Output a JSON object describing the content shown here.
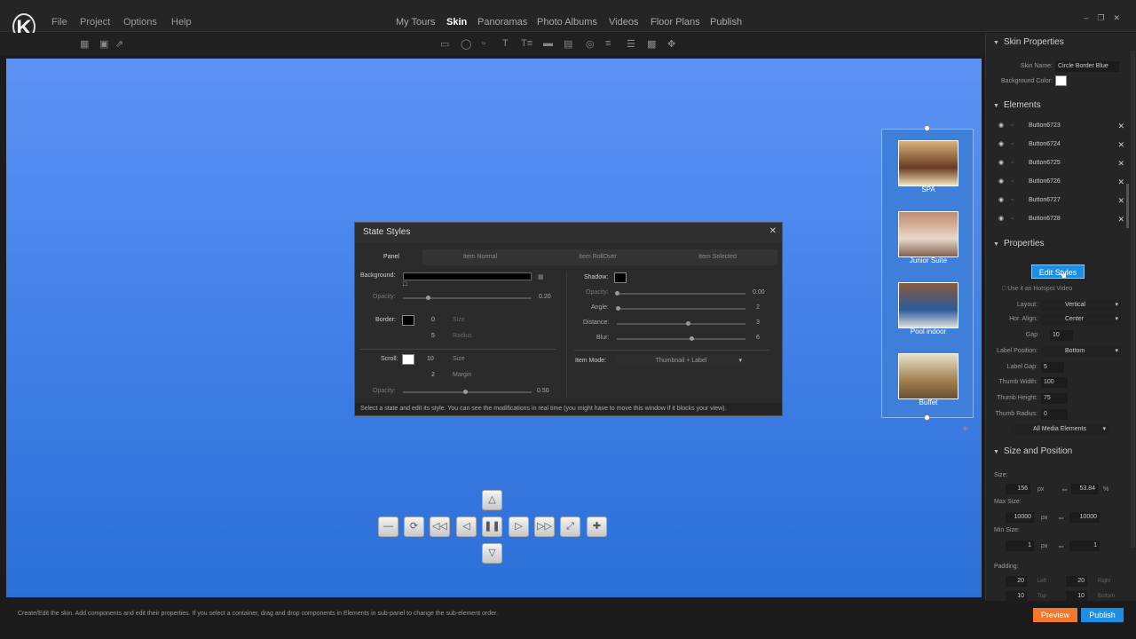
{
  "menu": [
    "File",
    "Project",
    "Options",
    "Help"
  ],
  "tabs": [
    {
      "label": "My Tours",
      "active": false
    },
    {
      "label": "Skin",
      "active": true
    },
    {
      "label": "Panoramas",
      "active": false
    },
    {
      "label": "Photo Albums",
      "active": false
    },
    {
      "label": "Videos",
      "active": false
    },
    {
      "label": "Floor Plans",
      "active": false
    },
    {
      "label": "Publish",
      "active": false
    }
  ],
  "skin_properties": {
    "header": "Skin Properties",
    "skin_name_label": "Skin Name:",
    "skin_name": "Circle Border Blue",
    "bg_color_label": "Background Color:"
  },
  "elements": {
    "header": "Elements",
    "items": [
      "Button6723",
      "Button6724",
      "Button6725",
      "Button6726",
      "Button6727",
      "Button6728"
    ]
  },
  "properties": {
    "header": "Properties",
    "edit_styles": "Edit Styles",
    "use_hotspot": "Use it as Hotspot Video",
    "layout_label": "Layout:",
    "layout": "Vertical",
    "hor_align_label": "Hor. Align:",
    "hor_align": "Center",
    "gap_label": "Gap",
    "gap": "10",
    "label_position_label": "Label Position:",
    "label_position": "Bottom",
    "label_gap_label": "Label Gap:",
    "label_gap": "5",
    "thumb_width_label": "Thumb Width:",
    "thumb_width": "100",
    "thumb_height_label": "Thumb Height:",
    "thumb_height": "75",
    "thumb_radius_label": "Thumb Radius:",
    "thumb_radius": "0",
    "media_filter": "All Media Elements"
  },
  "size_position": {
    "header": "Size and Position",
    "size_label": "Size:",
    "width": "156",
    "width_unit": "px",
    "height": "53.84",
    "height_unit": "%",
    "max_size_label": "Max Size:",
    "max_w": "10000",
    "max_unit": "px",
    "max_h": "10000",
    "min_size_label": "Min Size:",
    "min_w": "1",
    "min_unit": "px",
    "min_h": "1",
    "padding_label": "Padding:",
    "pad_left": "20",
    "pad_left_label": "Left",
    "pad_right": "20",
    "pad_right_label": "Right",
    "pad_top": "10",
    "pad_top_label": "Top",
    "pad_bottom": "10",
    "pad_bottom_label": "Bottom"
  },
  "status": "Create/Edit the skin. Add components and edit their properties. If you select a container, drag and drop components in Elements in sub-panel to change the sub-element order.",
  "preview": "Preview",
  "publish": "Publish",
  "dialog": {
    "title": "State Styles",
    "tabs": [
      "Panel",
      "Item Normal",
      "Item RollOver",
      "Item Selected"
    ],
    "background_label": "Background:",
    "opacity_label": "Opacity:",
    "opacity": "0.20",
    "border_label": "Border:",
    "border_size": "0",
    "size_label": "Size",
    "border_radius": "5",
    "radius_label": "Radius",
    "scroll_label": "Scroll:",
    "scroll_size": "10",
    "scroll_size_label": "Size",
    "scroll_margin": "2",
    "margin_label": "Margin",
    "opacity2_label": "Opacity:",
    "opacity2": "0.50",
    "shadow_label": "Shadow:",
    "sh_opacity_label": "Opacity:",
    "sh_opacity": "0.00",
    "angle_label": "Angle:",
    "angle": "2",
    "distance_label": "Distance:",
    "distance": "3",
    "blur_label": "Blur:",
    "blur": "6",
    "item_mode_label": "Item Mode:",
    "item_mode": "Thumbnail + Label",
    "footer": "Select a state and edit its style. You can see the modifications in real time (you might have to move this window if it blocks your view)."
  },
  "thumbnails": [
    {
      "label": "SPA",
      "color": "#8a5a3a"
    },
    {
      "label": "Junior Suite",
      "color": "#a0705a"
    },
    {
      "label": "Pool indoor",
      "color": "#3a6aa0"
    },
    {
      "label": "Buffet",
      "color": "#b8a070"
    }
  ],
  "colors": {
    "accent": "#1b8fe8",
    "preview": "#f2792c",
    "canvas": "#3f7fe6"
  }
}
